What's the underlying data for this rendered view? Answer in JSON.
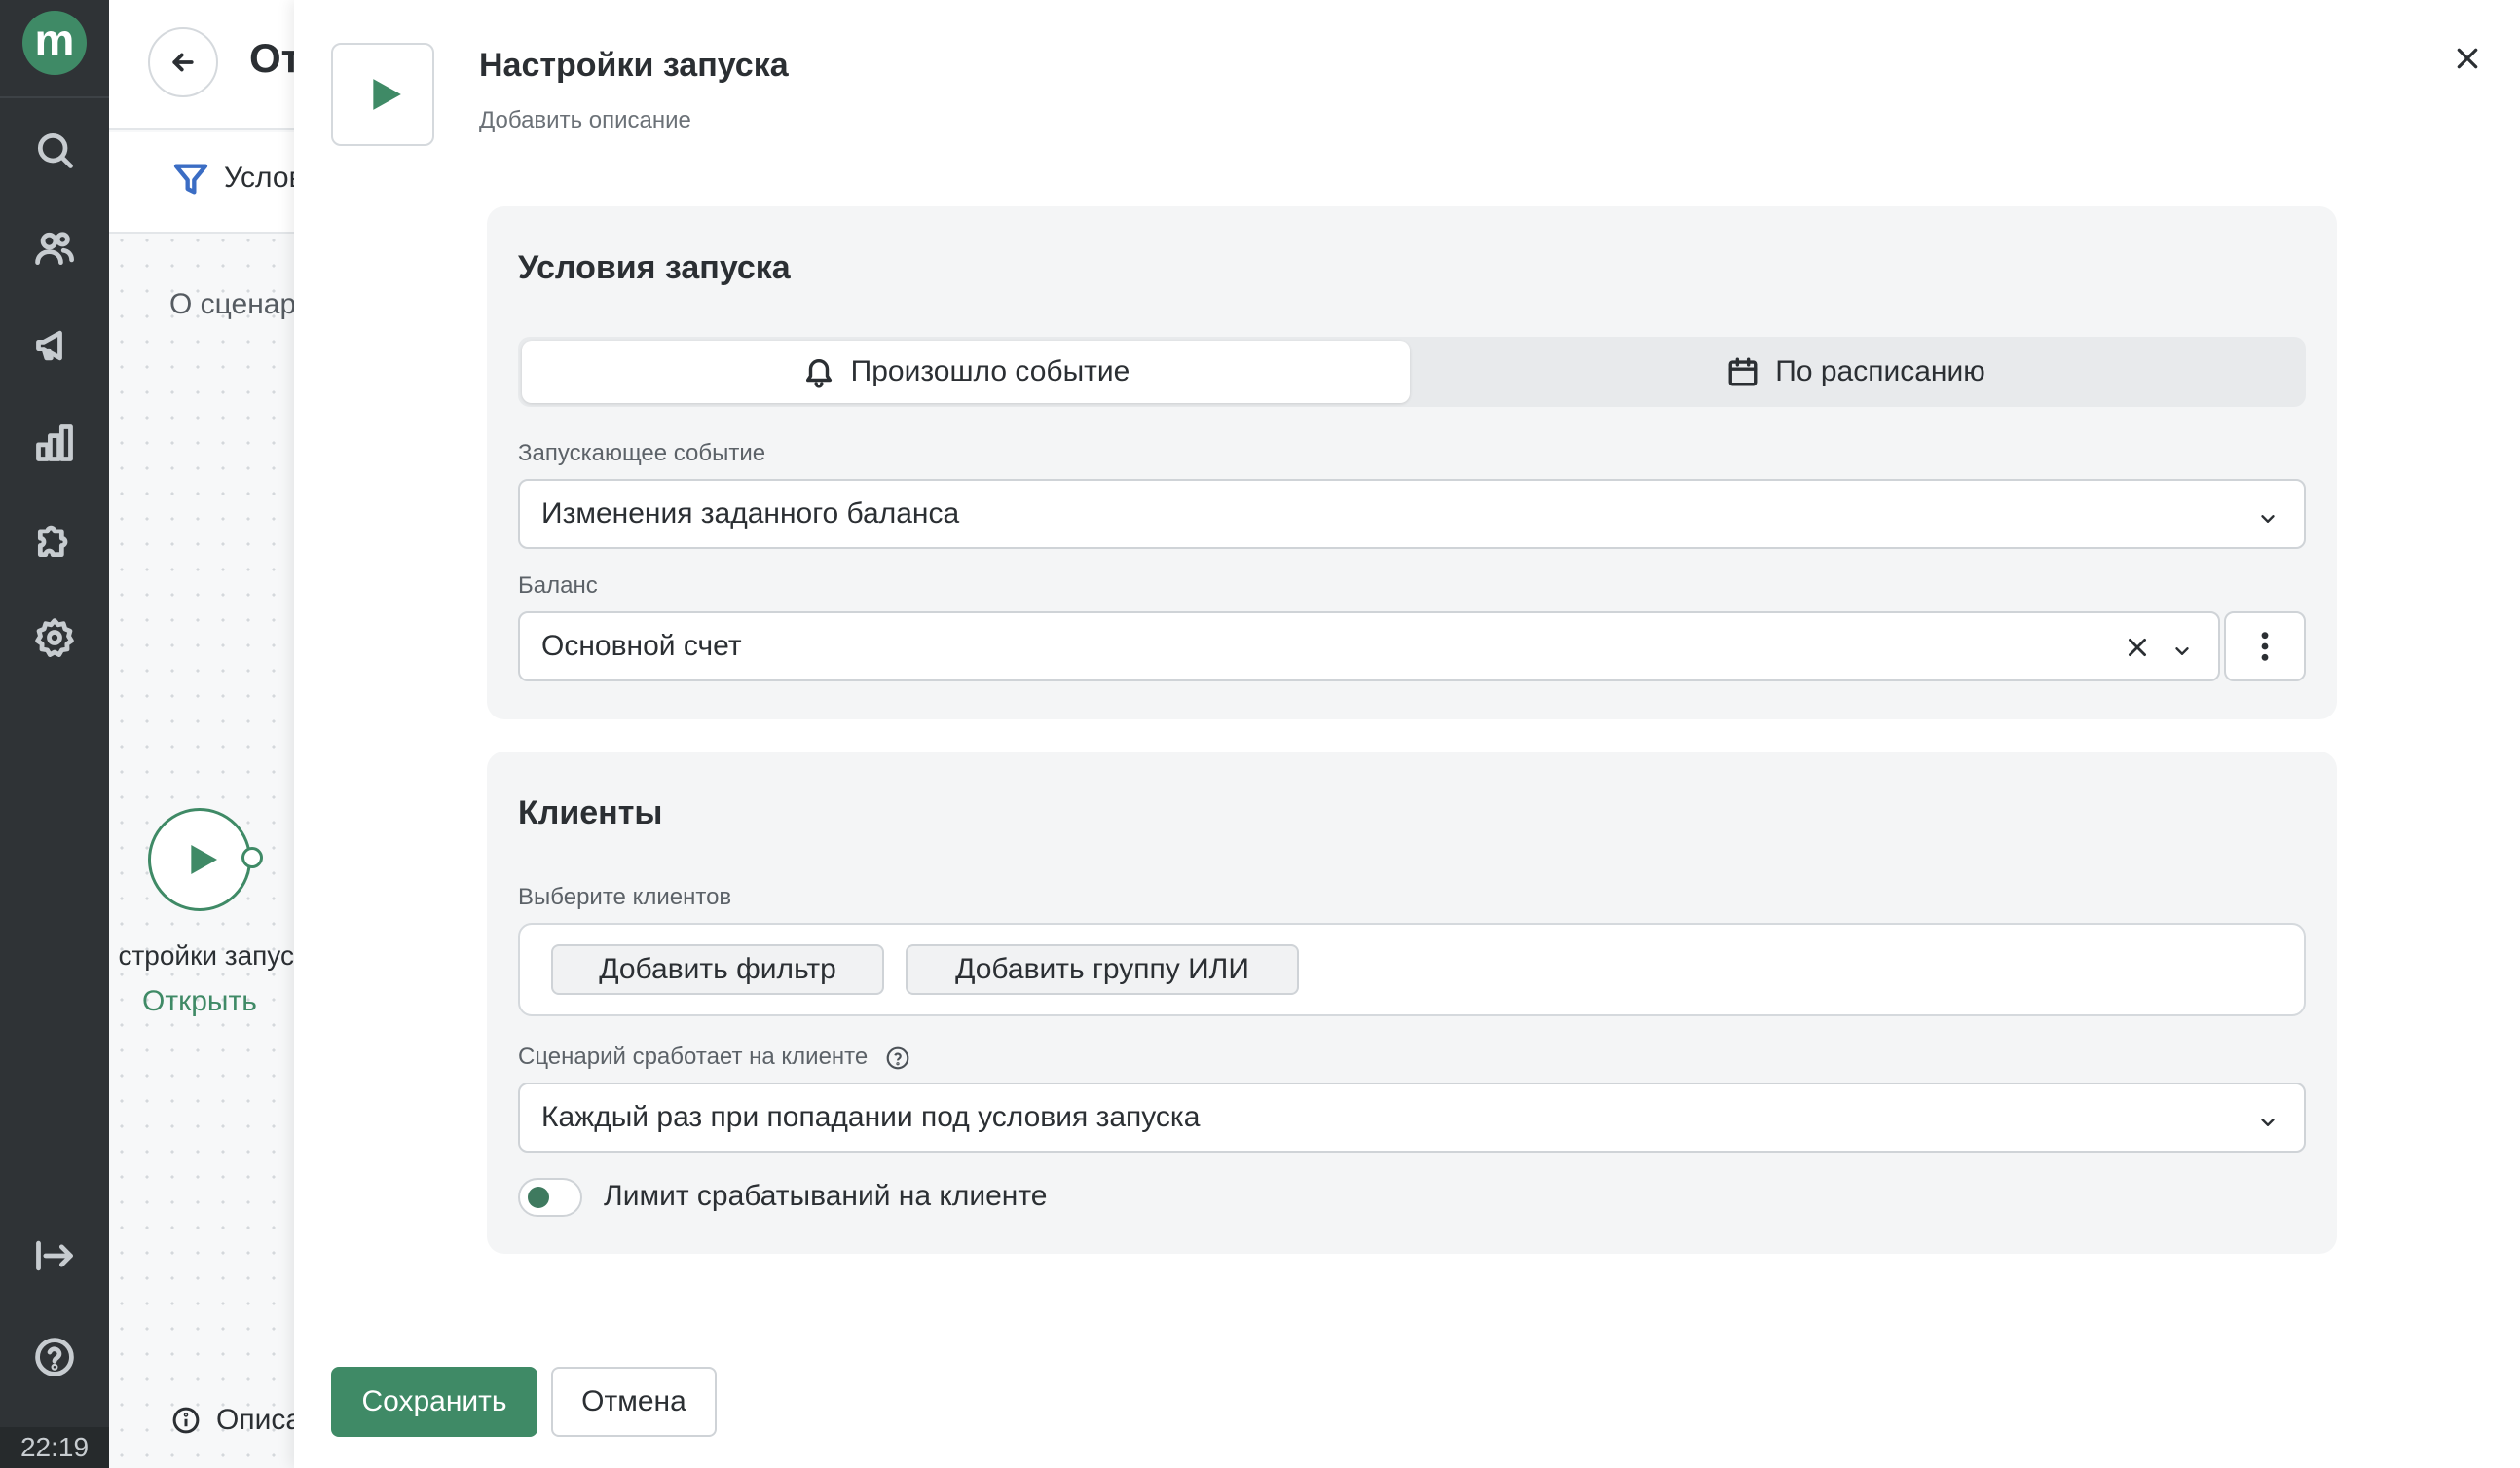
{
  "sidebar": {
    "logo_letter": "m",
    "icons": [
      "search-icon",
      "users-icon",
      "megaphone-icon",
      "bar-chart-icon",
      "puzzle-icon",
      "gear-icon",
      "collapse-icon",
      "help-icon"
    ],
    "clock": "22:19"
  },
  "background_page": {
    "title": "От",
    "tab_label": "Услов",
    "about_label": "О сценар",
    "node_label": "стройки запус",
    "node_open_link": "Открыть",
    "description_label": "Описа"
  },
  "modal": {
    "title": "Настройки запуска",
    "subtitle": "Добавить описание",
    "trigger_section": {
      "title": "Условия запуска",
      "tabs": [
        {
          "label": "Произошло событие",
          "icon": "bell-icon",
          "active": true
        },
        {
          "label": "По расписанию",
          "icon": "calendar-icon",
          "active": false
        }
      ],
      "event_field": {
        "label": "Запускающее событие",
        "value": "Изменения заданного баланса"
      },
      "balance_field": {
        "label": "Баланс",
        "value": "Основной счет"
      }
    },
    "clients_section": {
      "title": "Клиенты",
      "select_label": "Выберите клиентов",
      "add_filter": "Добавить фильтр",
      "add_or_group": "Добавить группу ИЛИ",
      "trigger_mode_label": "Сценарий сработает на клиенте",
      "trigger_mode_value": "Каждый раз при попадании под условия запуска",
      "limit_toggle_label": "Лимит срабатываний на клиенте"
    },
    "buttons": {
      "save": "Сохранить",
      "cancel": "Отмена"
    }
  },
  "colors": {
    "sidebar_bg": "#2f3336",
    "accent_green": "#3f8a66",
    "card_bg": "#f4f5f6",
    "filter_icon_blue": "#3b6dc4"
  }
}
